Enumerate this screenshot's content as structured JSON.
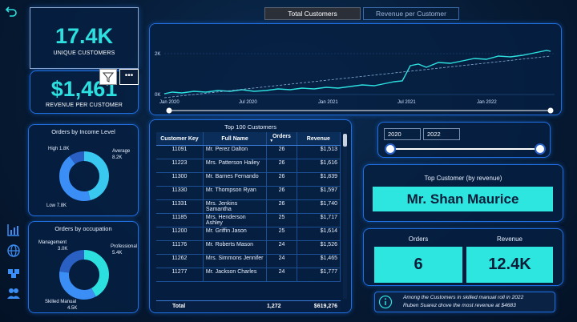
{
  "kpis": {
    "unique_customers_value": "17.4K",
    "unique_customers_label": "UNIQUE CUSTOMERS",
    "revenue_per_customer_value": "$1,461",
    "revenue_per_customer_label": "REVENUE PER CUSTOMER"
  },
  "tabs": [
    "Total Customers",
    "Revenue per Customer"
  ],
  "line_chart": {
    "y_ticks": [
      "2K",
      "0K"
    ],
    "x_ticks": [
      "Jan 2020",
      "Jul 2020",
      "Jan 2021",
      "Jul 2021",
      "Jan 2022"
    ]
  },
  "income_donut": {
    "title": "Orders by Income Level",
    "labels": [
      {
        "name": "High",
        "value": "1.8K"
      },
      {
        "name": "Average",
        "value": "8.2K"
      },
      {
        "name": "Low",
        "value": "7.8K"
      }
    ]
  },
  "occupation_donut": {
    "title": "Orders by occupation",
    "labels": [
      {
        "name": "Management",
        "value": "3.0K"
      },
      {
        "name": "Professional",
        "value": "5.4K"
      },
      {
        "name": "Skilled Manual",
        "value": "4.5K"
      }
    ]
  },
  "table": {
    "title": "Top 100 Customers",
    "columns": [
      "Customer Key",
      "Full Name",
      "Orders",
      "Revenue"
    ],
    "rows": [
      [
        "11091",
        "Mr. Perez Dalton",
        "26",
        "$1,513"
      ],
      [
        "11223",
        "Mrs. Patterson Hailey",
        "26",
        "$1,616"
      ],
      [
        "11300",
        "Mr. Barnes Fernando",
        "26",
        "$1,839"
      ],
      [
        "11330",
        "Mr. Thompson Ryan",
        "26",
        "$1,597"
      ],
      [
        "11331",
        "Mrs. Jenkins Samantha",
        "26",
        "$1,740"
      ],
      [
        "11185",
        "Mrs. Henderson Ashley",
        "25",
        "$1,717"
      ],
      [
        "11200",
        "Mr. Griffin Jason",
        "25",
        "$1,614"
      ],
      [
        "11176",
        "Mr. Roberts Mason",
        "24",
        "$1,526"
      ],
      [
        "11262",
        "Mrs. Simmons Jennifer",
        "24",
        "$1,465"
      ],
      [
        "11277",
        "Mr. Jackson Charles",
        "24",
        "$1,777"
      ]
    ],
    "total_label": "Total",
    "total_orders": "1,272",
    "total_revenue": "$619,276"
  },
  "year_slicer": {
    "start": "2020",
    "end": "2022"
  },
  "top_customer": {
    "title": "Top Customer (by revenue)",
    "name": "Mr. Shan Maurice",
    "orders_label": "Orders",
    "orders_value": "6",
    "revenue_label": "Revenue",
    "revenue_value": "12.4K"
  },
  "insight": {
    "line1": "Among the Customers in skilled manual roll in 2022",
    "line2": "Ruben Suarez drove the most revenue at $4683"
  },
  "colors": {
    "accent": "#2de0e0",
    "border": "#1f6fe0",
    "background": "#061a33"
  }
}
